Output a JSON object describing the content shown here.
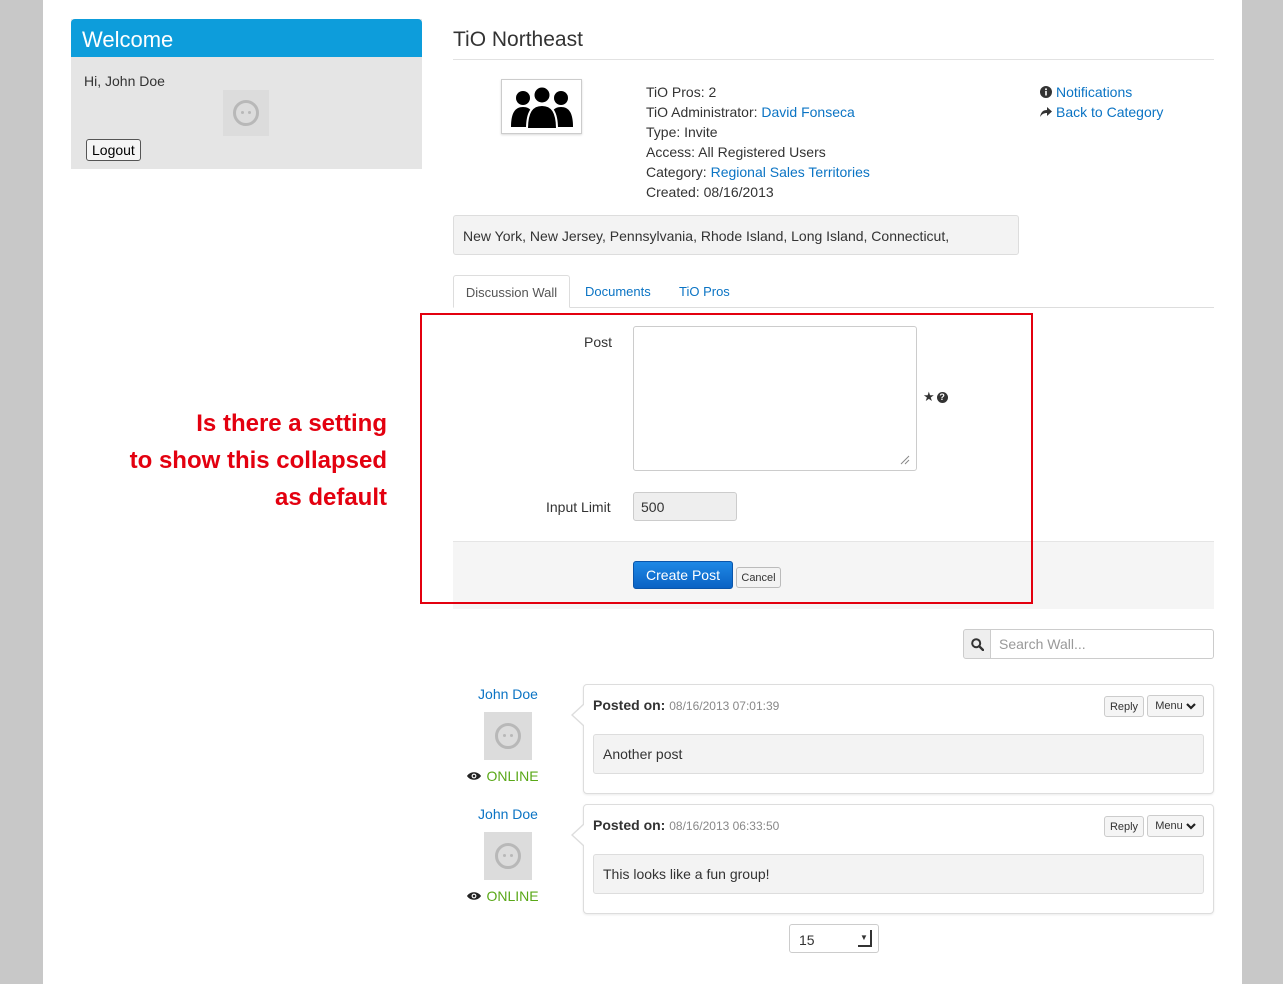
{
  "welcome": {
    "title": "Welcome",
    "greeting": "Hi, John Doe",
    "logout_label": "Logout"
  },
  "group": {
    "title": "TiO Northeast",
    "pros_line": "TiO Pros: 2",
    "admin_label": "TiO Administrator: ",
    "admin_name": "David Fonseca",
    "type_line": "Type: Invite",
    "access_line": "Access: All Registered Users",
    "category_label": "Category: ",
    "category_name": "Regional Sales Territories",
    "created_line": "Created: 08/16/2013",
    "states": "New York, New Jersey, Pennsylvania, Rhode Island, Long Island, Connecticut,"
  },
  "side_links": {
    "notifications": "Notifications",
    "back": "Back to Category"
  },
  "tabs": [
    {
      "label": "Discussion Wall",
      "active": true
    },
    {
      "label": "Documents",
      "active": false
    },
    {
      "label": "TiO Pros",
      "active": false
    }
  ],
  "form": {
    "post_label": "Post",
    "post_value": "",
    "required_marker": "★",
    "help_marker": "?",
    "limit_label": "Input Limit",
    "limit_value": "500",
    "create_label": "Create Post",
    "cancel_label": "Cancel"
  },
  "annotation": {
    "lines": [
      "Is there a setting",
      "to show this collapsed",
      "as default"
    ],
    "color": "#e3000f"
  },
  "search": {
    "placeholder": "Search Wall..."
  },
  "posts": [
    {
      "user": "John Doe",
      "status": "ONLINE",
      "posted_label": "Posted on:",
      "timestamp": "08/16/2013 07:01:39",
      "message": "Another post",
      "reply_label": "Reply",
      "menu_label": "Menu"
    },
    {
      "user": "John Doe",
      "status": "ONLINE",
      "posted_label": "Posted on:",
      "timestamp": "08/16/2013 06:33:50",
      "message": "This looks like a fun group!",
      "reply_label": "Reply",
      "menu_label": "Menu"
    }
  ],
  "pagination": {
    "per_page": "15"
  },
  "colors": {
    "accent": "#0d9ddb",
    "link": "#0b74c4",
    "online": "#5aa818",
    "button_primary": "#1e88e5"
  }
}
